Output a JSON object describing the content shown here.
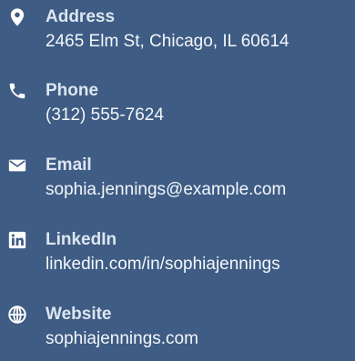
{
  "contacts": [
    {
      "icon": "map-pin-icon",
      "label": "Address",
      "value": "2465 Elm St, Chicago, IL 60614"
    },
    {
      "icon": "phone-icon",
      "label": "Phone",
      "value": "(312) 555-7624"
    },
    {
      "icon": "envelope-icon",
      "label": "Email",
      "value": "sophia.jennings@example.com"
    },
    {
      "icon": "linkedin-icon",
      "label": "LinkedIn",
      "value": "linkedin.com/in/sophiajennings"
    },
    {
      "icon": "globe-icon",
      "label": "Website",
      "value": "sophiajennings.com"
    }
  ],
  "colors": {
    "background": "#3e5c84",
    "label": "#dde6f1",
    "value": "#f4f7fb",
    "icon": "#ffffff"
  }
}
